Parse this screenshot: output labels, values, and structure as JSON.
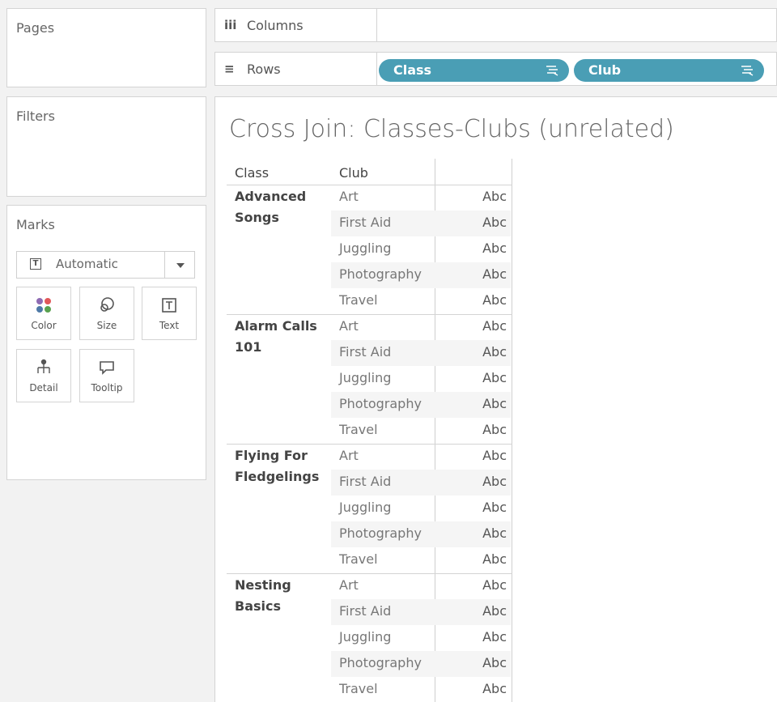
{
  "sidebar": {
    "pages_title": "Pages",
    "filters_title": "Filters",
    "marks_title": "Marks",
    "mark_type": "Automatic",
    "mark_cards": [
      {
        "label": "Color",
        "icon": "color-dots-icon"
      },
      {
        "label": "Size",
        "icon": "size-icon"
      },
      {
        "label": "Text",
        "icon": "text-icon"
      },
      {
        "label": "Detail",
        "icon": "detail-icon"
      },
      {
        "label": "Tooltip",
        "icon": "tooltip-icon"
      }
    ]
  },
  "shelves": {
    "columns_label": "Columns",
    "rows_label": "Rows",
    "row_pills": [
      "Class",
      "Club"
    ],
    "pill_color": "#4a9eb5"
  },
  "view": {
    "title": "Cross Join: Classes-Clubs (unrelated)",
    "headers": [
      "Class",
      "Club"
    ],
    "cell_text": "Abc",
    "classes": [
      {
        "name_lines": [
          "Advanced",
          "Songs"
        ],
        "clubs": [
          "Art",
          "First Aid",
          "Juggling",
          "Photography",
          "Travel"
        ]
      },
      {
        "name_lines": [
          "Alarm Calls",
          "101"
        ],
        "clubs": [
          "Art",
          "First Aid",
          "Juggling",
          "Photography",
          "Travel"
        ]
      },
      {
        "name_lines": [
          "Flying For",
          "Fledgelings"
        ],
        "clubs": [
          "Art",
          "First Aid",
          "Juggling",
          "Photography",
          "Travel"
        ]
      },
      {
        "name_lines": [
          "Nesting",
          "Basics"
        ],
        "clubs": [
          "Art",
          "First Aid",
          "Juggling",
          "Photography",
          "Travel"
        ]
      }
    ]
  }
}
